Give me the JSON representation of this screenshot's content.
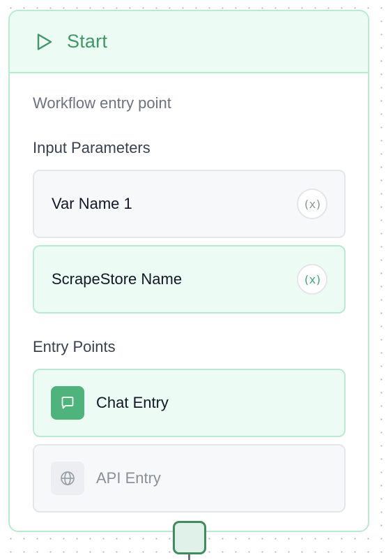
{
  "node": {
    "title": "Start",
    "title_icon": "play-icon",
    "description": "Workflow entry point",
    "accent_color": "#3f9868",
    "border_color": "#b8ecd2",
    "header_bg": "#ecfbf3"
  },
  "input_parameters": {
    "label": "Input Parameters",
    "items": [
      {
        "label": "Var Name 1",
        "badge": "(x)",
        "state": "default",
        "icon": "variable-icon"
      },
      {
        "label": "ScrapeStore Name",
        "badge": "(x)",
        "state": "selected",
        "icon": "variable-icon"
      }
    ]
  },
  "entry_points": {
    "label": "Entry Points",
    "items": [
      {
        "label": "Chat Entry",
        "icon": "chat-icon",
        "state": "active"
      },
      {
        "label": "API Entry",
        "icon": "globe-icon",
        "state": "inactive"
      }
    ]
  },
  "connector": {
    "icon": "output-handle"
  }
}
